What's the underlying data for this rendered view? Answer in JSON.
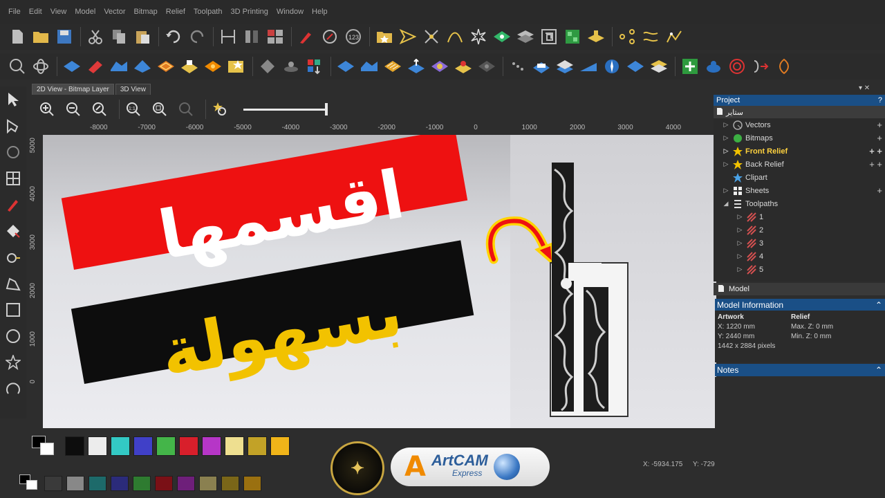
{
  "menu": [
    "File",
    "Edit",
    "View",
    "Model",
    "Vector",
    "Bitmap",
    "Relief",
    "Toolpath",
    "3D Printing",
    "Window",
    "Help"
  ],
  "tabs": {
    "tab1": "2D View - Bitmap Layer",
    "tab2": "3D View"
  },
  "ruler": {
    "h": [
      "-8000",
      "-7000",
      "-6000",
      "-5000",
      "-4000",
      "-3000",
      "-2000",
      "-1000",
      "0",
      "1000",
      "2000",
      "3000",
      "4000"
    ],
    "v": [
      "5000",
      "4000",
      "3000",
      "2000",
      "1000",
      "0"
    ]
  },
  "canvas": {
    "line1": "اقسمها",
    "line2": "بسهولة"
  },
  "project": {
    "title": "Project",
    "help": "?",
    "root": "ستاير",
    "items": [
      {
        "label": "Vectors"
      },
      {
        "label": "Bitmaps"
      },
      {
        "label": "Front Relief"
      },
      {
        "label": "Back Relief"
      },
      {
        "label": "Clipart"
      },
      {
        "label": "Sheets"
      },
      {
        "label": "Toolpaths"
      }
    ],
    "toolpaths": [
      "1",
      "2",
      "3",
      "4",
      "5"
    ]
  },
  "model": {
    "title": "Model",
    "info_title": "Model Information",
    "artwork_label": "Artwork",
    "x": "X: 1220 mm",
    "y": "Y: 2440 mm",
    "pixels": "1442 x 2884 pixels",
    "relief_label": "Relief",
    "maxz": "Max. Z: 0 mm",
    "minz": "Min. Z: 0 mm"
  },
  "notes": {
    "title": "Notes"
  },
  "palette": [
    "#0d0d0d",
    "#ececec",
    "#33c9c4",
    "#4040c8",
    "#44b549",
    "#d81f2b",
    "#b636c7",
    "#eedf90",
    "#c2a227",
    "#f0b419"
  ],
  "palette2": [
    "#3a3a3a",
    "#888888",
    "#1d6a6a",
    "#2b2b7a",
    "#2e7b30",
    "#7a1016",
    "#6e1f7a",
    "#8a8050",
    "#7a6618",
    "#9a7010"
  ],
  "status": {
    "x": "X: -5934.175",
    "y": "Y: -729"
  },
  "logo": {
    "brand": "ArtCAM",
    "sub": "Express",
    "letter": "A"
  }
}
